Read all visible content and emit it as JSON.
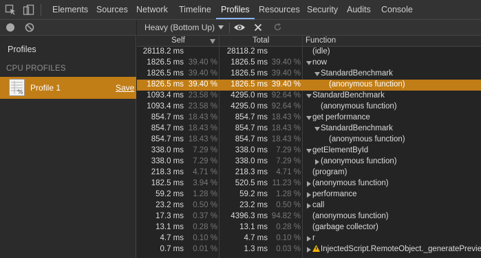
{
  "tabs": [
    "Elements",
    "Sources",
    "Network",
    "Timeline",
    "Profiles",
    "Resources",
    "Security",
    "Audits",
    "Console"
  ],
  "active_tab": "Profiles",
  "sidebar": {
    "title": "Profiles",
    "section": "CPU PROFILES",
    "profile_name": "Profile 1",
    "save_label": "Save"
  },
  "toolbar": {
    "view_mode": "Heavy (Bottom Up)"
  },
  "columns": {
    "self": "Self",
    "total": "Total",
    "function": "Function"
  },
  "colors": {
    "accent": "#c17d16",
    "tab_underline": "#8ab4f8"
  },
  "rows": [
    {
      "self": "28118.2 ms",
      "self_pct": "",
      "total": "28118.2 ms",
      "total_pct": "",
      "func": "(idle)",
      "depth": 0,
      "arrow": "none"
    },
    {
      "self": "1826.5 ms",
      "self_pct": "39.40 %",
      "total": "1826.5 ms",
      "total_pct": "39.40 %",
      "func": "now",
      "depth": 0,
      "arrow": "down"
    },
    {
      "self": "1826.5 ms",
      "self_pct": "39.40 %",
      "total": "1826.5 ms",
      "total_pct": "39.40 %",
      "func": "StandardBenchmark",
      "depth": 1,
      "arrow": "down"
    },
    {
      "self": "1826.5 ms",
      "self_pct": "39.40 %",
      "total": "1826.5 ms",
      "total_pct": "39.40 %",
      "func": "(anonymous function)",
      "depth": 2,
      "arrow": "none",
      "selected": true
    },
    {
      "self": "1093.4 ms",
      "self_pct": "23.58 %",
      "total": "4295.0 ms",
      "total_pct": "92.64 %",
      "func": "StandardBenchmark",
      "depth": 0,
      "arrow": "down"
    },
    {
      "self": "1093.4 ms",
      "self_pct": "23.58 %",
      "total": "4295.0 ms",
      "total_pct": "92.64 %",
      "func": "(anonymous function)",
      "depth": 1,
      "arrow": "none"
    },
    {
      "self": "854.7 ms",
      "self_pct": "18.43 %",
      "total": "854.7 ms",
      "total_pct": "18.43 %",
      "func": "get performance",
      "depth": 0,
      "arrow": "down"
    },
    {
      "self": "854.7 ms",
      "self_pct": "18.43 %",
      "total": "854.7 ms",
      "total_pct": "18.43 %",
      "func": "StandardBenchmark",
      "depth": 1,
      "arrow": "down"
    },
    {
      "self": "854.7 ms",
      "self_pct": "18.43 %",
      "total": "854.7 ms",
      "total_pct": "18.43 %",
      "func": "(anonymous function)",
      "depth": 2,
      "arrow": "none"
    },
    {
      "self": "338.0 ms",
      "self_pct": "7.29 %",
      "total": "338.0 ms",
      "total_pct": "7.29 %",
      "func": "getElementById",
      "depth": 0,
      "arrow": "down"
    },
    {
      "self": "338.0 ms",
      "self_pct": "7.29 %",
      "total": "338.0 ms",
      "total_pct": "7.29 %",
      "func": "(anonymous function)",
      "depth": 1,
      "arrow": "right"
    },
    {
      "self": "218.3 ms",
      "self_pct": "4.71 %",
      "total": "218.3 ms",
      "total_pct": "4.71 %",
      "func": "(program)",
      "depth": 0,
      "arrow": "none"
    },
    {
      "self": "182.5 ms",
      "self_pct": "3.94 %",
      "total": "520.5 ms",
      "total_pct": "11.23 %",
      "func": "(anonymous function)",
      "depth": 0,
      "arrow": "right"
    },
    {
      "self": "59.2 ms",
      "self_pct": "1.28 %",
      "total": "59.2 ms",
      "total_pct": "1.28 %",
      "func": "performance",
      "depth": 0,
      "arrow": "right"
    },
    {
      "self": "23.2 ms",
      "self_pct": "0.50 %",
      "total": "23.2 ms",
      "total_pct": "0.50 %",
      "func": "call",
      "depth": 0,
      "arrow": "right"
    },
    {
      "self": "17.3 ms",
      "self_pct": "0.37 %",
      "total": "4396.3 ms",
      "total_pct": "94.82 %",
      "func": "(anonymous function)",
      "depth": 0,
      "arrow": "none"
    },
    {
      "self": "13.1 ms",
      "self_pct": "0.28 %",
      "total": "13.1 ms",
      "total_pct": "0.28 %",
      "func": "(garbage collector)",
      "depth": 0,
      "arrow": "none"
    },
    {
      "self": "4.7 ms",
      "self_pct": "0.10 %",
      "total": "4.7 ms",
      "total_pct": "0.10 %",
      "func": "r",
      "depth": 0,
      "arrow": "right"
    },
    {
      "self": "0.7 ms",
      "self_pct": "0.01 %",
      "total": "1.3 ms",
      "total_pct": "0.03 %",
      "func": "InjectedScript.RemoteObject._generatePreview",
      "depth": 0,
      "arrow": "right",
      "warning": true
    }
  ]
}
